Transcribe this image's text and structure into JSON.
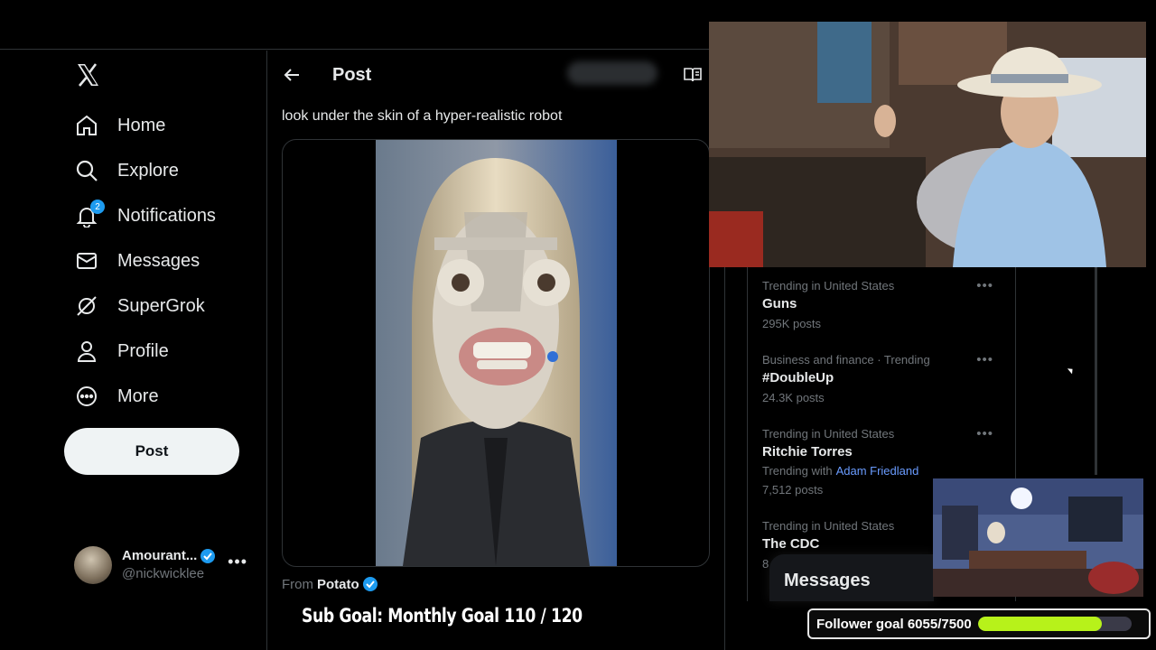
{
  "nav": {
    "logo": "x-logo-icon",
    "items": [
      {
        "label": "Home",
        "icon": "home-icon"
      },
      {
        "label": "Explore",
        "icon": "search-icon"
      },
      {
        "label": "Notifications",
        "icon": "bell-icon",
        "badge": "2"
      },
      {
        "label": "Messages",
        "icon": "envelope-icon"
      },
      {
        "label": "SuperGrok",
        "icon": "grok-icon"
      },
      {
        "label": "Profile",
        "icon": "person-icon"
      },
      {
        "label": "More",
        "icon": "more-circle-icon"
      }
    ],
    "post_label": "Post",
    "account": {
      "name": "Amourant...",
      "handle": "@nickwicklee",
      "more": "•••"
    }
  },
  "header": {
    "title": "Post"
  },
  "post": {
    "text": "look under the skin of a hyper-realistic robot",
    "from_label": "From",
    "from_name": "Potato"
  },
  "trends": [
    {
      "meta": "Trending in United States",
      "name": "Guns",
      "count": "295K posts"
    },
    {
      "meta": "Business and finance · Trending",
      "name": "#DoubleUp",
      "count": "24.3K posts"
    },
    {
      "meta": "Trending in United States",
      "name": "Ritchie Torres",
      "with_label": "Trending with",
      "with_name": "Adam Friedland",
      "count": "7,512 posts"
    },
    {
      "meta": "Trending in United States",
      "name": "The CDC",
      "count": "8"
    }
  ],
  "messages_dock": {
    "label": "Messages"
  },
  "overlay": {
    "sub_goal": "Sub Goal: Monthly Goal  110 / 120",
    "follower_goal": "Follower goal 6055/7500",
    "follower_progress": 0.807
  },
  "colors": {
    "accent": "#1d9bf0",
    "progress": "#b7f21a",
    "verified": "#1d9bf0",
    "link": "#6a9cff"
  }
}
